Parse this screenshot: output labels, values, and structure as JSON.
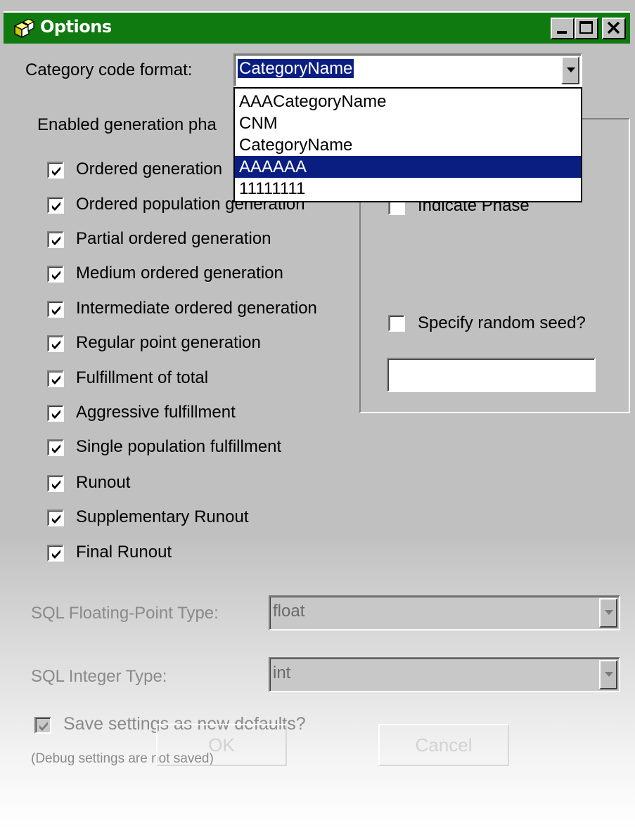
{
  "window": {
    "title": "Options"
  },
  "title_icon": "cube-icon",
  "title_buttons": [
    "minimize-icon",
    "maximize-icon",
    "close-icon"
  ],
  "category_code": {
    "label": "Category code format:",
    "value": "CategoryName",
    "options": [
      "AAACategoryName",
      "CNM",
      "CategoryName",
      "AAAAAA",
      "11111111"
    ],
    "highlighted": "AAAAAA"
  },
  "phases": {
    "label_visible": "Enabled generation pha",
    "items": [
      {
        "label": "Ordered generation",
        "checked": true
      },
      {
        "label": "Ordered population generation",
        "checked": true
      },
      {
        "label": "Partial ordered generation",
        "checked": true
      },
      {
        "label": "Medium ordered generation",
        "checked": true
      },
      {
        "label": "Intermediate ordered generation",
        "checked": true
      },
      {
        "label": "Regular point generation",
        "checked": true
      },
      {
        "label": "Fulfillment of total",
        "checked": true
      },
      {
        "label": "Aggressive fulfillment",
        "checked": true
      },
      {
        "label": "Single population fulfillment",
        "checked": true
      },
      {
        "label": "Runout",
        "checked": true
      },
      {
        "label": "Supplementary Runout",
        "checked": true
      },
      {
        "label": "Final Runout",
        "checked": true
      }
    ]
  },
  "random_group": {
    "indicate_phase_label": "Indicate Phase",
    "indicate_phase_checked": false,
    "seed_label": "Specify random seed?",
    "seed_checked": false,
    "seed_value": ""
  },
  "sql": {
    "float_label": "SQL Floating-Point Type:",
    "float_value": "float",
    "int_label": "SQL Integer Type:",
    "int_value": "int"
  },
  "save_defaults": {
    "label": "Save settings as new defaults?",
    "checked": true,
    "note": "(Debug settings are not saved)"
  },
  "buttons": {
    "ok": "OK",
    "cancel": "Cancel"
  },
  "colors": {
    "titlebar": "#0f7a0f",
    "highlight": "#0a1e82",
    "face": "#c0c0c0"
  }
}
